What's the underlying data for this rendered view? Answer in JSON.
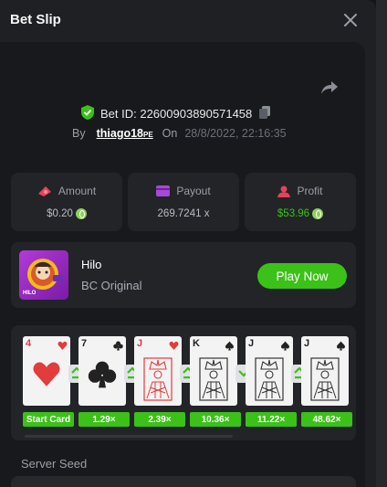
{
  "header": {
    "title": "Bet Slip"
  },
  "bet": {
    "id_label": "Bet ID: 22600903890571458",
    "by_label": "By",
    "user": "thiago18",
    "user_suffix": "PE",
    "on_label": "On",
    "date": "28/8/2022, 22:16:35"
  },
  "stats": [
    {
      "label": "Amount",
      "value": "$0.20",
      "value_color": "#b8bcc3"
    },
    {
      "label": "Payout",
      "value": "269.7241 x",
      "value_color": "#b8bcc3"
    },
    {
      "label": "Profit",
      "value": "$53.96",
      "value_color": "#3bc117"
    }
  ],
  "game": {
    "name": "Hilo",
    "provider": "BC Original",
    "play_label": "Play Now",
    "thumb_label": "HILO"
  },
  "cards": [
    {
      "rank": "4",
      "suit": "heart",
      "color": "#e23c3c",
      "mult": "Start Card",
      "arrow": "up"
    },
    {
      "rank": "7",
      "suit": "club",
      "color": "#222",
      "mult": "1.29×",
      "arrow": "up"
    },
    {
      "rank": "J",
      "suit": "heart",
      "color": "#e23c3c",
      "mult": "2.39×",
      "arrow": "up"
    },
    {
      "rank": "K",
      "suit": "spade",
      "color": "#222",
      "mult": "10.36×",
      "arrow": "down"
    },
    {
      "rank": "J",
      "suit": "spade",
      "color": "#222",
      "mult": "11.22×",
      "arrow": "up"
    },
    {
      "rank": "J",
      "suit": "spade",
      "color": "#222",
      "mult": "48.62×",
      "arrow": ""
    }
  ],
  "seed": {
    "label": "Server Seed"
  },
  "colors": {
    "accent": "#3bc117",
    "background": "#18191c",
    "card_bg": "#222428"
  }
}
